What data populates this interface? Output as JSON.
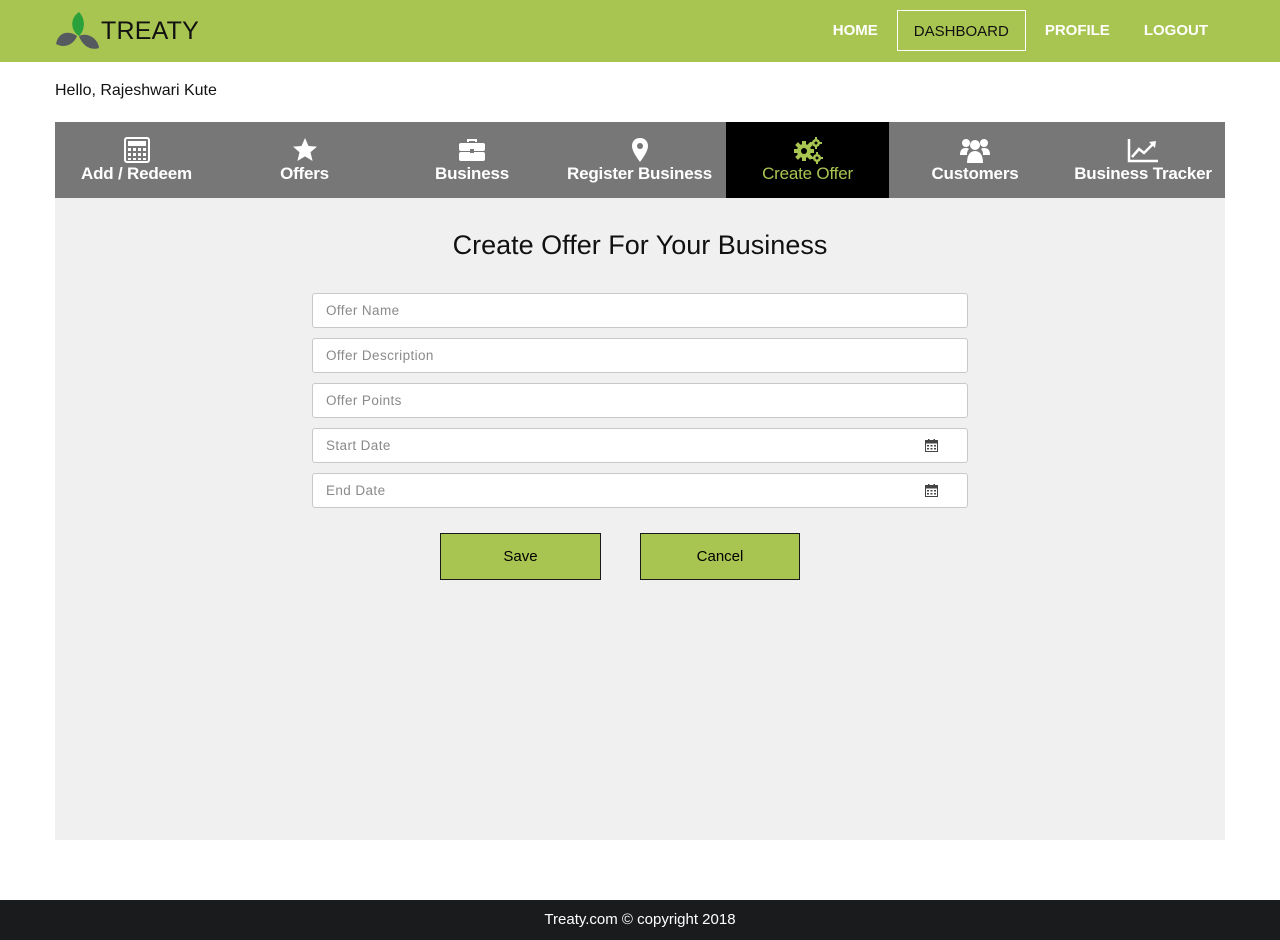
{
  "brand": {
    "name": "TREATY",
    "accent": "#a9c551"
  },
  "nav": [
    {
      "label": "HOME",
      "active": false
    },
    {
      "label": "DASHBOARD",
      "active": true
    },
    {
      "label": "PROFILE",
      "active": false
    },
    {
      "label": "LOGOUT",
      "active": false
    }
  ],
  "greeting": "Hello, Rajeshwari Kute",
  "tabs": [
    {
      "label": "Add / Redeem",
      "icon": "calculator-icon",
      "active": false
    },
    {
      "label": "Offers",
      "icon": "star-icon",
      "active": false
    },
    {
      "label": "Business",
      "icon": "briefcase-icon",
      "active": false
    },
    {
      "label": "Register Business",
      "icon": "map-marker-icon",
      "active": false
    },
    {
      "label": "Create Offer",
      "icon": "gears-icon",
      "active": true
    },
    {
      "label": "Customers",
      "icon": "users-icon",
      "active": false
    },
    {
      "label": "Business Tracker",
      "icon": "line-chart-icon",
      "active": false
    }
  ],
  "form": {
    "title": "Create Offer For Your Business",
    "fields": {
      "offer_name": {
        "placeholder": "Offer Name",
        "value": ""
      },
      "offer_description": {
        "placeholder": "Offer Description",
        "value": ""
      },
      "offer_points": {
        "placeholder": "Offer Points",
        "value": ""
      },
      "start_date": {
        "placeholder": "Start Date",
        "value": "",
        "icon": "calendar-icon"
      },
      "end_date": {
        "placeholder": "End Date",
        "value": "",
        "icon": "calendar-icon"
      }
    },
    "save_label": "Save",
    "cancel_label": "Cancel"
  },
  "footer": "Treaty.com © copyright 2018"
}
